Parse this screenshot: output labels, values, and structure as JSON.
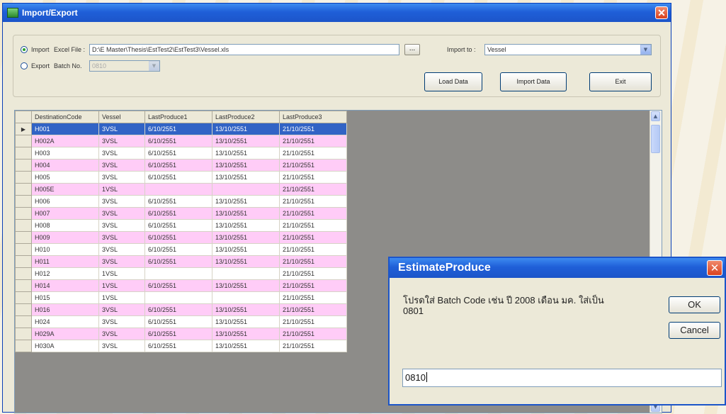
{
  "window": {
    "title": "Import/Export"
  },
  "import_export": {
    "import_label": "Import",
    "excel_file_label": "Excel File :",
    "excel_file_path": "D:\\E Master\\Thesis\\EstTest2\\EstTest3\\Vessel.xls",
    "browse_label": "...",
    "import_to_label": "Import to :",
    "import_to_value": "Vessel",
    "export_label": "Export",
    "batch_no_label": "Batch No.",
    "batch_no_value": "0810",
    "selected_mode": "import"
  },
  "buttons": {
    "load": "Load Data",
    "import": "Import Data",
    "exit": "Exit"
  },
  "grid": {
    "columns": [
      "DestinationCode",
      "Vessel",
      "LastProduce1",
      "LastProduce2",
      "LastProduce3"
    ],
    "rows": [
      [
        "H001",
        "3VSL",
        "6/10/2551",
        "13/10/2551",
        "21/10/2551"
      ],
      [
        "H002A",
        "3VSL",
        "6/10/2551",
        "13/10/2551",
        "21/10/2551"
      ],
      [
        "H003",
        "3VSL",
        "6/10/2551",
        "13/10/2551",
        "21/10/2551"
      ],
      [
        "H004",
        "3VSL",
        "6/10/2551",
        "13/10/2551",
        "21/10/2551"
      ],
      [
        "H005",
        "3VSL",
        "6/10/2551",
        "13/10/2551",
        "21/10/2551"
      ],
      [
        "H005E",
        "1VSL",
        "",
        "",
        "21/10/2551"
      ],
      [
        "H006",
        "3VSL",
        "6/10/2551",
        "13/10/2551",
        "21/10/2551"
      ],
      [
        "H007",
        "3VSL",
        "6/10/2551",
        "13/10/2551",
        "21/10/2551"
      ],
      [
        "H008",
        "3VSL",
        "6/10/2551",
        "13/10/2551",
        "21/10/2551"
      ],
      [
        "H009",
        "3VSL",
        "6/10/2551",
        "13/10/2551",
        "21/10/2551"
      ],
      [
        "H010",
        "3VSL",
        "6/10/2551",
        "13/10/2551",
        "21/10/2551"
      ],
      [
        "H011",
        "3VSL",
        "6/10/2551",
        "13/10/2551",
        "21/10/2551"
      ],
      [
        "H012",
        "1VSL",
        "",
        "",
        "21/10/2551"
      ],
      [
        "H014",
        "1VSL",
        "6/10/2551",
        "13/10/2551",
        "21/10/2551"
      ],
      [
        "H015",
        "1VSL",
        "",
        "",
        "21/10/2551"
      ],
      [
        "H016",
        "3VSL",
        "6/10/2551",
        "13/10/2551",
        "21/10/2551"
      ],
      [
        "H024",
        "3VSL",
        "6/10/2551",
        "13/10/2551",
        "21/10/2551"
      ],
      [
        "H029A",
        "3VSL",
        "6/10/2551",
        "13/10/2551",
        "21/10/2551"
      ],
      [
        "H030A",
        "3VSL",
        "6/10/2551",
        "13/10/2551",
        "21/10/2551"
      ]
    ],
    "selected_row_index": 0,
    "row_colors": {
      "odd": "#ffffff",
      "even": "#ffccf7",
      "selected": "#3163c5"
    }
  },
  "dialog": {
    "title": "EstimateProduce",
    "message_line1": "โปรดใส่ Batch Code เช่น ปี 2008 เดือน มค. ใส่เป็น",
    "message_line2": "0801",
    "ok_label": "OK",
    "cancel_label": "Cancel",
    "input_value": "0810"
  },
  "colors": {
    "titlebar": "#1f5fd8",
    "window_face": "#ece9d8",
    "close_button": "#d9411e"
  }
}
